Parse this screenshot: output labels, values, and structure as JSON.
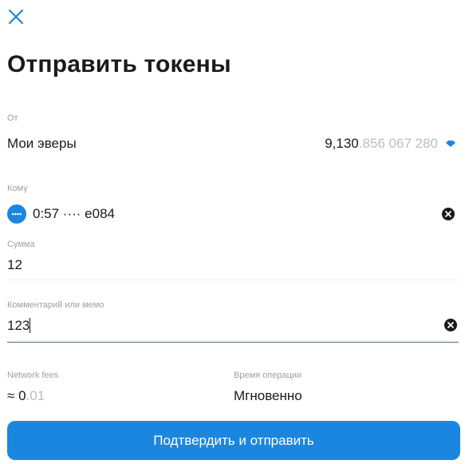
{
  "title": "Отправить токены",
  "from": {
    "label": "От",
    "account_name": "Мои эверы",
    "balance_main": "9,130",
    "balance_fraction": ".856 067 280"
  },
  "to": {
    "label": "Кому",
    "address": "0:57 ···· e084"
  },
  "amount": {
    "label": "Сумма",
    "value": "12"
  },
  "comment": {
    "label": "Комментарий или мемо",
    "value": "123"
  },
  "fees": {
    "label": "Network fees",
    "approx_prefix": "≈ ",
    "value_main": "0",
    "value_fraction": ".01"
  },
  "time": {
    "label": "Время операции",
    "value": "Мгновенно"
  },
  "confirm_button": "Подтвердить и отправить",
  "colors": {
    "accent": "#1b86e0",
    "muted_text": "#9aa1a8",
    "active_underline": "#4d6f8f"
  },
  "icons": {
    "close": "close-icon",
    "token": "ever-token-icon",
    "avatar": "address-avatar-icon",
    "clear": "clear-icon"
  }
}
